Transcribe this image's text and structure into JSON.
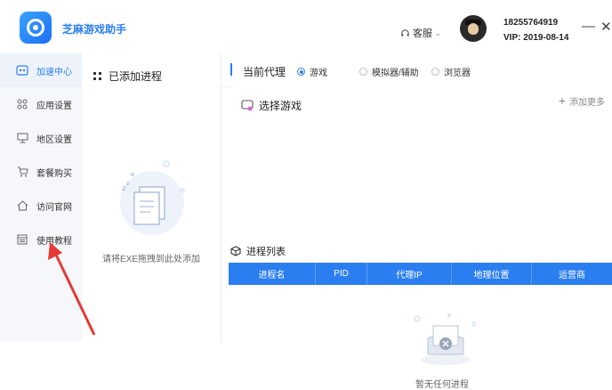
{
  "app": {
    "title": "芝麻游戏助手"
  },
  "header": {
    "customer_service": "客服",
    "phone": "18255764919",
    "vip": "VIP: 2019-08-14",
    "minimize": "—",
    "close": "✕"
  },
  "nav": {
    "items": [
      {
        "label": "加速中心",
        "icon": "gamepad-icon",
        "active": true
      },
      {
        "label": "应用设置",
        "icon": "grid-icon"
      },
      {
        "label": "地区设置",
        "icon": "monitor-icon"
      },
      {
        "label": "套餐购买",
        "icon": "cart-icon"
      },
      {
        "label": "访问官网",
        "icon": "home-icon"
      },
      {
        "label": "使用教程",
        "icon": "book-icon"
      }
    ]
  },
  "process_panel": {
    "title": "已添加进程",
    "hint": "请将EXE拖拽到此处添加"
  },
  "proxy": {
    "title": "当前代理",
    "options": [
      {
        "label": "游戏",
        "selected": true
      },
      {
        "label": "模拟器/辅助"
      },
      {
        "label": "浏览器"
      }
    ]
  },
  "game_section": {
    "title": "选择游戏",
    "add_more": "添加更多"
  },
  "process_list": {
    "title": "进程列表",
    "columns": [
      "进程名",
      "PID",
      "代理IP",
      "地理位置",
      "运营商"
    ],
    "empty_text": "暂无任何进程"
  },
  "colors": {
    "accent": "#2b7ef0",
    "annotation_arrow": "#e53935"
  }
}
